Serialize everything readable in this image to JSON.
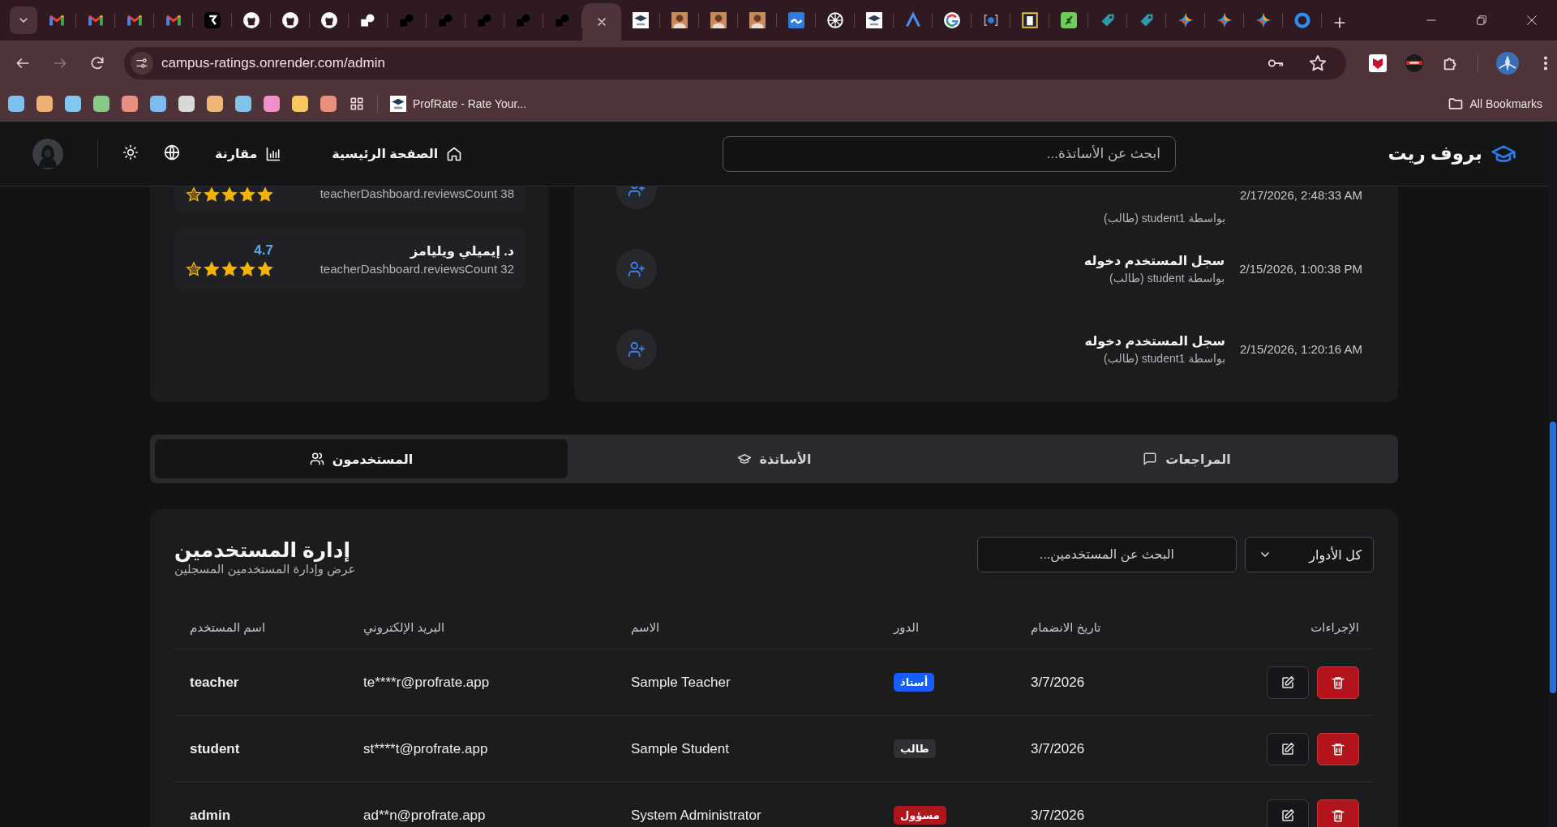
{
  "browser": {
    "tabs": [
      {
        "kind": "mail",
        "selected": false
      },
      {
        "kind": "mail",
        "selected": false
      },
      {
        "kind": "mail",
        "selected": false
      },
      {
        "kind": "mail",
        "selected": false
      },
      {
        "kind": "app",
        "selected": false
      },
      {
        "kind": "round",
        "selected": false
      },
      {
        "kind": "round",
        "selected": false
      },
      {
        "kind": "round",
        "selected": false
      },
      {
        "kind": "block-light",
        "selected": false
      },
      {
        "kind": "block",
        "selected": false
      },
      {
        "kind": "block",
        "selected": false
      },
      {
        "kind": "block",
        "selected": false
      },
      {
        "kind": "block",
        "selected": false
      },
      {
        "kind": "block",
        "selected": false
      },
      {
        "selected": true
      },
      {
        "kind": "cap",
        "selected": false
      },
      {
        "kind": "person",
        "selected": false
      },
      {
        "kind": "person",
        "selected": false
      },
      {
        "kind": "person",
        "selected": false
      },
      {
        "kind": "tile",
        "selected": false
      },
      {
        "kind": "wheel",
        "selected": false
      },
      {
        "kind": "cap",
        "selected": false
      },
      {
        "kind": "arch",
        "selected": false
      },
      {
        "kind": "ring-logo",
        "selected": false
      },
      {
        "kind": "brackets",
        "selected": false
      },
      {
        "kind": "frame",
        "selected": false
      },
      {
        "kind": "leaf",
        "selected": false
      },
      {
        "kind": "tag",
        "selected": false
      },
      {
        "kind": "tag",
        "selected": false
      },
      {
        "kind": "sparkle",
        "selected": false
      },
      {
        "kind": "sparkle",
        "selected": false
      },
      {
        "kind": "sparkle",
        "selected": false
      },
      {
        "kind": "ring",
        "selected": false
      }
    ],
    "address": "campus-ratings.onrender.com/admin",
    "bookmarks": [
      {
        "color": "#7cc0f0"
      },
      {
        "color": "#f0b070"
      },
      {
        "color": "#80c8f0"
      },
      {
        "color": "#88c888"
      },
      {
        "color": "#e89080"
      },
      {
        "color": "#7cbcf0"
      },
      {
        "color": "#d8d8d8"
      },
      {
        "color": "#f0b478"
      },
      {
        "color": "#80c4ec"
      },
      {
        "color": "#f090c8"
      },
      {
        "color": "#f8c860"
      },
      {
        "color": "#e8907c"
      }
    ],
    "bookmark_link": "ProfRate - Rate Your...",
    "all_bookmarks": "All Bookmarks"
  },
  "app": {
    "brand": "بروف ريت",
    "search_placeholder": "ابحث عن الأساتذة...",
    "nav": [
      {
        "kind": "home",
        "label": "الصفحة الرئيسية"
      },
      {
        "kind": "compare",
        "label": "مقارنة"
      }
    ]
  },
  "top_teachers": [
    {
      "reviews": "38 teacherDashboard.reviewsCount",
      "stars": 4
    },
    {
      "name": "د. إيميلي ويليامز",
      "rating": "4.7",
      "reviews": "32 teacherDashboard.reviewsCount",
      "stars": 4
    }
  ],
  "activity": [
    {
      "by": "بواسطة student1 (طالب)",
      "time": "2/17/2026, 2:48:33 AM"
    },
    {
      "title": "سجل المستخدم دخوله",
      "by": "بواسطة student (طالب)",
      "time": "2/15/2026, 1:00:38 PM"
    },
    {
      "title": "سجل المستخدم دخوله",
      "by": "بواسطة student1 (طالب)",
      "time": "2/15/2026, 1:20:16 AM"
    }
  ],
  "tabs": [
    {
      "kind": "reviews",
      "label": "المراجعات",
      "selected": false
    },
    {
      "kind": "teachers",
      "label": "الأساتذة",
      "selected": false
    },
    {
      "kind": "users",
      "label": "المستخدمون",
      "selected": true
    }
  ],
  "users": {
    "title": "إدارة المستخدمين",
    "subtitle": "عرض وإدارة المستخدمين المسجلين",
    "search_placeholder": "البحث عن المستخدمين...",
    "role_filter": "كل الأدوار",
    "columns": [
      "الإجراءات",
      "تاريخ الانضمام",
      "الدور",
      "الاسم",
      "البريد الإلكتروني",
      "اسم المستخدم"
    ],
    "rows": [
      {
        "username": "teacher",
        "email": "te****r@profrate.app",
        "name": "Sample Teacher",
        "role": {
          "label": "أستاذ",
          "color": "#155dfc"
        },
        "joined": "3/7/2026"
      },
      {
        "username": "student",
        "email": "st****t@profrate.app",
        "name": "Sample Student",
        "role": {
          "label": "طالب",
          "color": "#2f3034"
        },
        "joined": "3/7/2026"
      },
      {
        "username": "admin",
        "email": "ad**n@profrate.app",
        "name": "System Administrator",
        "role": {
          "label": "مسؤول",
          "color": "#b3141b"
        },
        "joined": "3/7/2026"
      }
    ]
  }
}
